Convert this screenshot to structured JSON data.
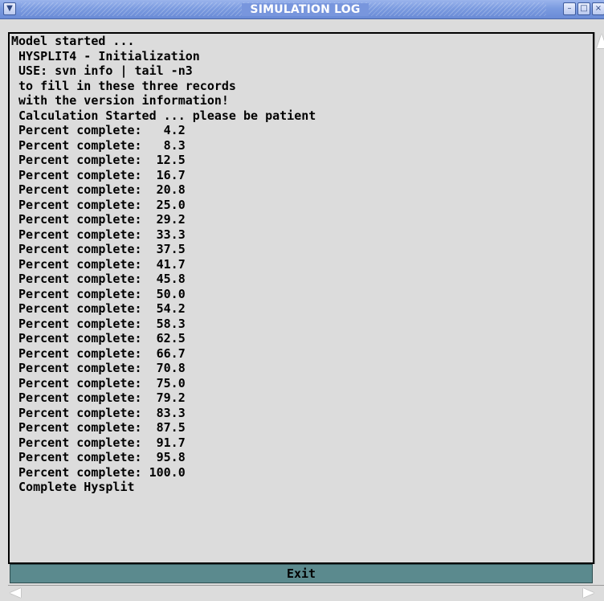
{
  "window": {
    "title": "SIMULATION LOG",
    "icons": {
      "menu": "chevron-down-icon",
      "minimize": "minimize-icon",
      "maximize": "maximize-icon",
      "close": "close-icon"
    },
    "colors": {
      "titlebar": "#7b9be0",
      "exit_button": "#5b8a8e",
      "background": "#dcdcdc"
    }
  },
  "log": {
    "lines": [
      "Model started ...",
      " HYSPLIT4 - Initialization",
      " USE: svn info | tail -n3",
      " to fill in these three records",
      " with the version information!",
      " Calculation Started ... please be patient",
      " Percent complete:   4.2",
      " Percent complete:   8.3",
      " Percent complete:  12.5",
      " Percent complete:  16.7",
      " Percent complete:  20.8",
      " Percent complete:  25.0",
      " Percent complete:  29.2",
      " Percent complete:  33.3",
      " Percent complete:  37.5",
      " Percent complete:  41.7",
      " Percent complete:  45.8",
      " Percent complete:  50.0",
      " Percent complete:  54.2",
      " Percent complete:  58.3",
      " Percent complete:  62.5",
      " Percent complete:  66.7",
      " Percent complete:  70.8",
      " Percent complete:  75.0",
      " Percent complete:  79.2",
      " Percent complete:  83.3",
      " Percent complete:  87.5",
      " Percent complete:  91.7",
      " Percent complete:  95.8",
      " Percent complete: 100.0",
      " Complete Hysplit"
    ]
  },
  "footer": {
    "exit_label": "Exit"
  }
}
